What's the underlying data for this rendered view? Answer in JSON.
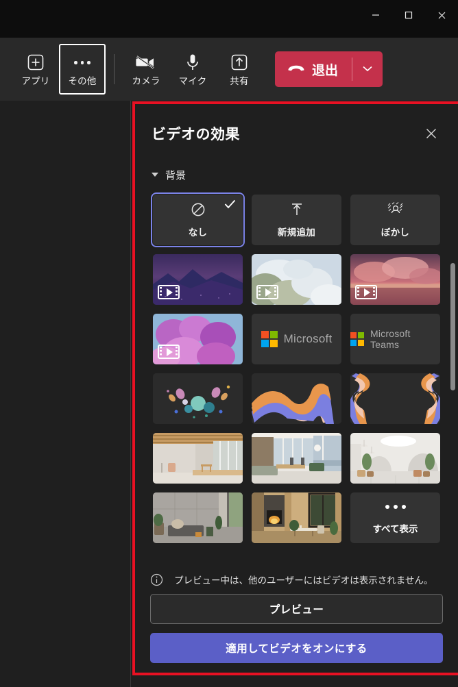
{
  "window": {
    "controls": [
      {
        "name": "minimize",
        "icon": "minimize-icon"
      },
      {
        "name": "maximize",
        "icon": "maximize-icon"
      },
      {
        "name": "close",
        "icon": "close-icon"
      }
    ]
  },
  "toolbar": {
    "items": [
      {
        "label": "アプリ",
        "icon": "apps-plus-icon",
        "focused": false
      },
      {
        "label": "その他",
        "icon": "more-dots-icon",
        "focused": true
      },
      {
        "label": "カメラ",
        "icon": "camera-off-icon",
        "focused": false
      },
      {
        "label": "マイク",
        "icon": "microphone-icon",
        "focused": false
      },
      {
        "label": "共有",
        "icon": "share-up-arrow-icon",
        "focused": false
      }
    ],
    "leave": {
      "label": "退出",
      "icon": "hangup-phone-icon",
      "chevron_icon": "chevron-down-icon",
      "color": "#c4314b"
    }
  },
  "panel": {
    "title": "ビデオの効果",
    "close_icon": "close-icon",
    "section": {
      "title": "背景",
      "caret_icon": "caret-down-icon",
      "expanded": true
    },
    "tiles": [
      {
        "id": "none",
        "label": "なし",
        "kind": "action",
        "icon": "no-background-icon",
        "selected": true
      },
      {
        "id": "add-new",
        "label": "新規追加",
        "kind": "action",
        "icon": "upload-arrow-icon",
        "selected": false
      },
      {
        "id": "blur",
        "label": "ぼかし",
        "kind": "action",
        "icon": "blur-icon",
        "selected": false
      },
      {
        "id": "vid-mountain",
        "label": "",
        "kind": "video",
        "art": "mountain-night",
        "selected": false
      },
      {
        "id": "vid-clouds",
        "label": "",
        "kind": "video",
        "art": "white-clouds",
        "selected": false
      },
      {
        "id": "vid-sunset",
        "label": "",
        "kind": "video",
        "art": "pink-clouds-sea",
        "selected": false
      },
      {
        "id": "vid-flowers",
        "label": "",
        "kind": "video",
        "art": "purple-flowers",
        "selected": false
      },
      {
        "id": "ms-logo",
        "label": "Microsoft",
        "kind": "brand",
        "art": "microsoft-logo",
        "selected": false
      },
      {
        "id": "ms-teams",
        "label": "Microsoft Teams",
        "kind": "brand",
        "art": "microsoft-logo",
        "selected": false
      },
      {
        "id": "abs-bubbles",
        "label": "",
        "kind": "image",
        "art": "abstract-bubbles",
        "selected": false
      },
      {
        "id": "abs-ribbon1",
        "label": "",
        "kind": "image",
        "art": "abstract-ribbon-wave",
        "selected": false
      },
      {
        "id": "abs-ribbon2",
        "label": "",
        "kind": "image",
        "art": "abstract-ribbon-pair",
        "selected": false
      },
      {
        "id": "room-wood",
        "label": "",
        "kind": "image",
        "art": "room-wood-beams",
        "selected": false
      },
      {
        "id": "room-lounge",
        "label": "",
        "kind": "image",
        "art": "room-window-lounge",
        "selected": false
      },
      {
        "id": "room-white",
        "label": "",
        "kind": "image",
        "art": "room-white-arches",
        "selected": false
      },
      {
        "id": "room-concrete",
        "label": "",
        "kind": "image",
        "art": "room-concrete-sofa",
        "selected": false
      },
      {
        "id": "room-fire",
        "label": "",
        "kind": "image",
        "art": "room-fireplace",
        "selected": false
      },
      {
        "id": "show-all",
        "label": "すべて表示",
        "kind": "show-all",
        "icon": "more-dots-icon",
        "selected": false
      }
    ],
    "notice": {
      "icon": "info-circle-icon",
      "text": "プレビュー中は、他のユーザーにはビデオは表示されません。"
    },
    "preview_button": "プレビュー",
    "apply_button": "適用してビデオをオンにする"
  },
  "colors": {
    "accent": "#5b5fc7",
    "selection": "#7b83e8",
    "danger": "#c4314b",
    "highlight_frame": "#e81123",
    "panel_bg": "#1f1f1f",
    "tile_bg": "#333333",
    "toolbar_bg": "#292929"
  }
}
